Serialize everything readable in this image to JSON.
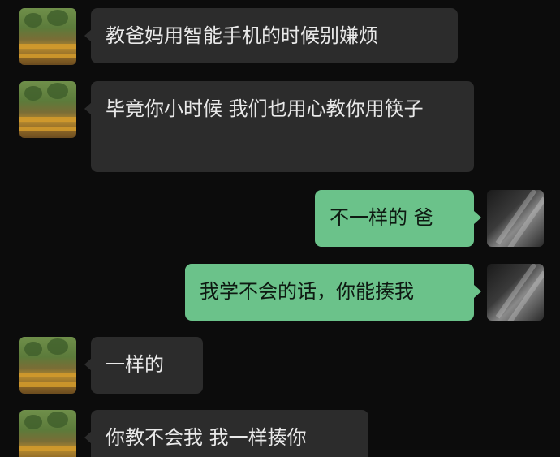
{
  "messages": [
    {
      "side": "in",
      "text": "教爸妈用智能手机的时候别嫌烦"
    },
    {
      "side": "in",
      "text": "毕竟你小时候 我们也用心教你用筷子"
    },
    {
      "side": "out",
      "text": "不一样的 爸"
    },
    {
      "side": "out",
      "text": "我学不会的话，你能揍我"
    },
    {
      "side": "in",
      "text": "一样的"
    },
    {
      "side": "in",
      "text": "你教不会我 我一样揍你"
    }
  ],
  "colors": {
    "background": "#0c0c0c",
    "incoming_bubble": "#2c2c2c",
    "outgoing_bubble": "#6bc28a"
  }
}
